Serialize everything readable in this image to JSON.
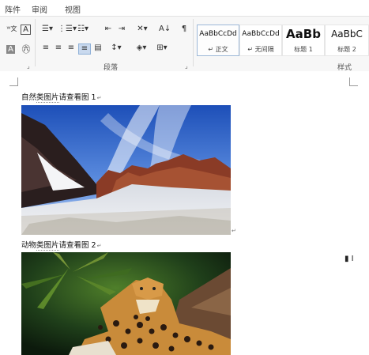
{
  "tabs": [
    "阵件",
    "审阅",
    "视图"
  ],
  "ribbon": {
    "paragraph_group_label": "段落",
    "styles_group_label": "样式",
    "styles": [
      {
        "sample": "AaBbCcDd",
        "name": "↵ 正文"
      },
      {
        "sample": "AaBbCcDd",
        "name": "↵ 无间隔"
      },
      {
        "sample": "AaBb",
        "name": "标题 1"
      },
      {
        "sample": "AaBbC",
        "name": "标题 2"
      }
    ]
  },
  "document": {
    "caption1_prefix": "自然",
    "caption1_underlined": "类图片",
    "caption1_suffix": "请查看图 1",
    "caption2_prefix": "动物",
    "caption2_underlined": "类图片",
    "caption2_suffix": "请查看图 2",
    "paragraph_mark": "↵"
  }
}
